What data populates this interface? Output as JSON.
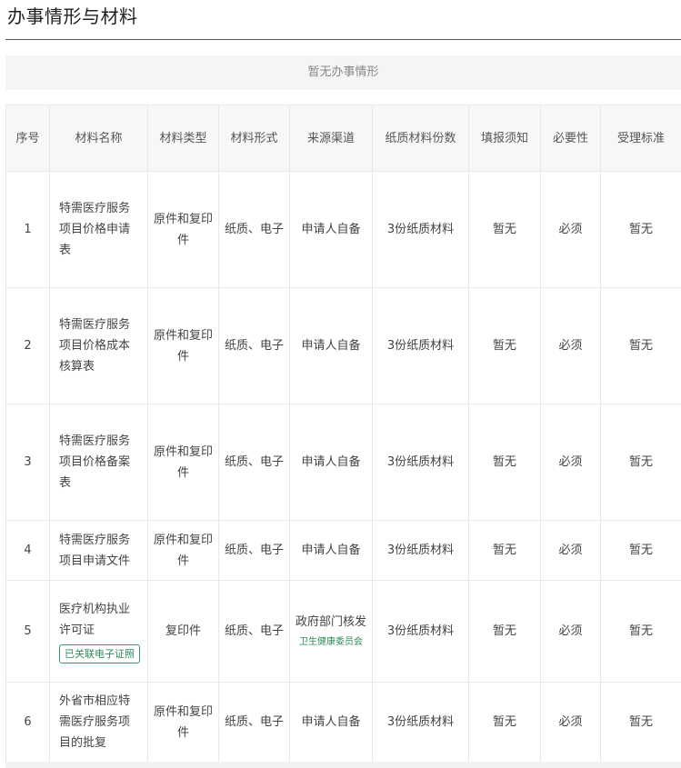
{
  "section": {
    "title": "办事情形与材料",
    "empty_situation_text": "暂无办事情形"
  },
  "table": {
    "headers": {
      "index": "序号",
      "name": "材料名称",
      "type": "材料类型",
      "form": "材料形式",
      "source": "来源渠道",
      "copies": "纸质材料份数",
      "notes": "填报须知",
      "required": "必要性",
      "standard": "受理标准"
    },
    "rows": [
      {
        "index": "1",
        "name": "特需医疗服务项目价格申请表",
        "tag": "",
        "type": "原件和复印件",
        "form": "纸质、电子",
        "source": "申请人自备",
        "source_sub": "",
        "copies": "3份纸质材料",
        "notes": "暂无",
        "required": "必须",
        "standard": "暂无"
      },
      {
        "index": "2",
        "name": "特需医疗服务项目价格成本核算表",
        "tag": "",
        "type": "原件和复印件",
        "form": "纸质、电子",
        "source": "申请人自备",
        "source_sub": "",
        "copies": "3份纸质材料",
        "notes": "暂无",
        "required": "必须",
        "standard": "暂无"
      },
      {
        "index": "3",
        "name": "特需医疗服务项目价格备案表",
        "tag": "",
        "type": "原件和复印件",
        "form": "纸质、电子",
        "source": "申请人自备",
        "source_sub": "",
        "copies": "3份纸质材料",
        "notes": "暂无",
        "required": "必须",
        "standard": "暂无"
      },
      {
        "index": "4",
        "name": "特需医疗服务项目申请文件",
        "tag": "",
        "type": "原件和复印件",
        "form": "纸质、电子",
        "source": "申请人自备",
        "source_sub": "",
        "copies": "3份纸质材料",
        "notes": "暂无",
        "required": "必须",
        "standard": "暂无"
      },
      {
        "index": "5",
        "name": "医疗机构执业许可证",
        "tag": "已关联电子证照",
        "type": "复印件",
        "form": "纸质、电子",
        "source": "政府部门核发",
        "source_sub": "卫生健康委员会",
        "copies": "3份纸质材料",
        "notes": "暂无",
        "required": "必须",
        "standard": "暂无"
      },
      {
        "index": "6",
        "name": "外省市相应特需医疗服务项目的批复",
        "tag": "",
        "type": "原件和复印件",
        "form": "纸质、电子",
        "source": "申请人自备",
        "source_sub": "",
        "copies": "3份纸质材料",
        "notes": "暂无",
        "required": "必须",
        "standard": "暂无"
      }
    ]
  }
}
